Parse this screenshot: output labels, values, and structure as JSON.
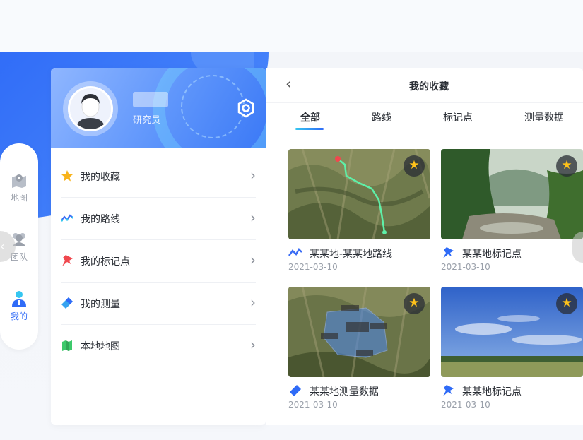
{
  "nav": {
    "items": [
      {
        "label": "地图",
        "icon": "map-pin-icon"
      },
      {
        "label": "团队",
        "icon": "team-icon"
      },
      {
        "label": "我的",
        "icon": "user-icon"
      }
    ]
  },
  "profile": {
    "role": "研究员",
    "menu": [
      {
        "label": "我的收藏",
        "icon": "star-icon"
      },
      {
        "label": "我的路线",
        "icon": "route-icon"
      },
      {
        "label": "我的标记点",
        "icon": "pin-icon"
      },
      {
        "label": "我的测量",
        "icon": "ruler-icon"
      },
      {
        "label": "本地地图",
        "icon": "local-map-icon"
      }
    ]
  },
  "favorites": {
    "title": "我的收藏",
    "tabs": [
      "全部",
      "路线",
      "标记点",
      "测量数据"
    ],
    "cards": [
      {
        "title": "某某地-某某地路线",
        "date": "2021-03-10",
        "icon": "route-icon"
      },
      {
        "title": "某某地标记点",
        "date": "2021-03-10",
        "icon": "pin-icon"
      },
      {
        "title": "某某地测量数据",
        "date": "2021-03-10",
        "icon": "ruler-icon"
      },
      {
        "title": "某某地标记点",
        "date": "2021-03-10",
        "icon": "pin-icon"
      }
    ]
  },
  "colors": {
    "accent": "#2f6bf7",
    "star": "#ffc21a",
    "route": "#3b6df5"
  }
}
